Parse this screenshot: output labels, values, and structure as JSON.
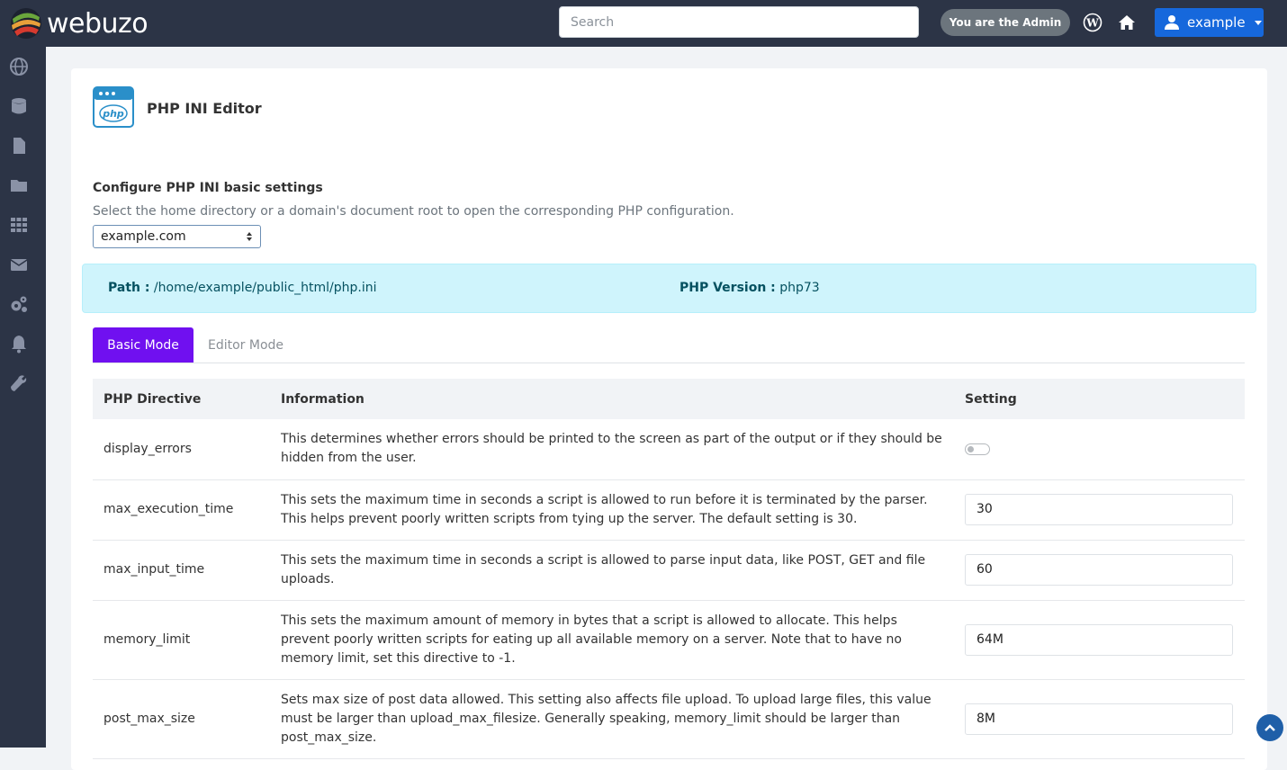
{
  "header": {
    "brand": "webuzo",
    "search_placeholder": "Search",
    "admin_label": "You are the Admin",
    "user_label": "example"
  },
  "sidebar": {
    "icons": [
      "globe-icon",
      "database-icon",
      "file-icon",
      "folder-icon",
      "apps-grid-icon",
      "mail-icon",
      "settings-cogs-icon",
      "bell-icon",
      "wrench-icon"
    ]
  },
  "page": {
    "title": "PHP INI Editor",
    "section_title": "Configure PHP INI basic settings",
    "section_desc": "Select the home directory or a domain's document root to open the corresponding PHP configuration.",
    "domain_selected": "example.com",
    "path_label": "Path :",
    "path_value": "/home/example/public_html/php.ini",
    "version_label": "PHP Version :",
    "version_value": "php73",
    "tabs": [
      {
        "label": "Basic Mode",
        "active": true
      },
      {
        "label": "Editor Mode",
        "active": false
      }
    ]
  },
  "table": {
    "headers": [
      "PHP Directive",
      "Information",
      "Setting"
    ],
    "rows": [
      {
        "directive": "display_errors",
        "info": "This determines whether errors should be printed to the screen as part of the output or if they should be hidden from the user.",
        "type": "toggle",
        "value": "off"
      },
      {
        "directive": "max_execution_time",
        "info": "This sets the maximum time in seconds a script is allowed to run before it is terminated by the parser. This helps prevent poorly written scripts from tying up the server. The default setting is 30.",
        "type": "input",
        "value": "30"
      },
      {
        "directive": "max_input_time",
        "info": "This sets the maximum time in seconds a script is allowed to parse input data, like POST, GET and file uploads.",
        "type": "input",
        "value": "60"
      },
      {
        "directive": "memory_limit",
        "info": "This sets the maximum amount of memory in bytes that a script is allowed to allocate. This helps prevent poorly written scripts for eating up all available memory on a server. Note that to have no memory limit, set this directive to -1.",
        "type": "input",
        "value": "64M"
      },
      {
        "directive": "post_max_size",
        "info": "Sets max size of post data allowed. This setting also affects file upload. To upload large files, this value must be larger than upload_max_filesize. Generally speaking, memory_limit should be larger than post_max_size.",
        "type": "input",
        "value": "8M"
      }
    ]
  },
  "colors": {
    "topbar": "#2c3446",
    "active_tab": "#7010f0",
    "user_button": "#1668dc",
    "info_box": "#cff4fc"
  }
}
